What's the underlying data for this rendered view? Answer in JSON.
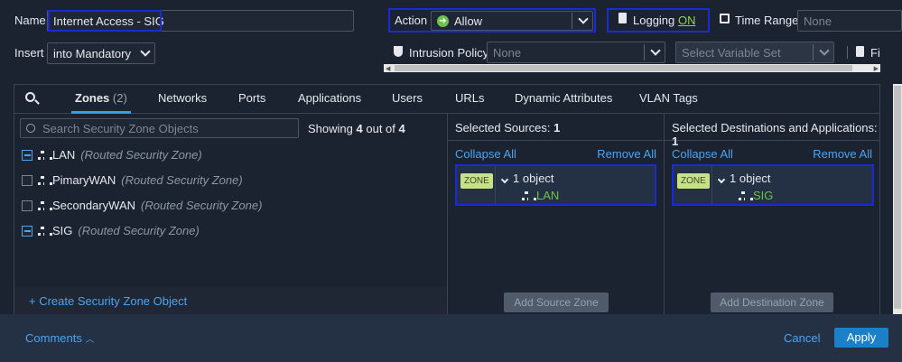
{
  "form": {
    "name_label": "Name",
    "name_value": "Internet Access - SIG",
    "action_label": "Action",
    "action_value": "Allow",
    "logging_label": "Logging",
    "logging_value": "ON",
    "time_range_label": "Time Range",
    "time_range_placeholder": "None",
    "insert_label": "Insert",
    "insert_value": "into Mandatory",
    "intrusion_label": "Intrusion Policy",
    "intrusion_value": "None",
    "variable_set_placeholder": "Select Variable Set",
    "file_label": "Fi"
  },
  "tabs": [
    {
      "label": "Zones",
      "count": "(2)"
    },
    {
      "label": "Networks"
    },
    {
      "label": "Ports"
    },
    {
      "label": "Applications"
    },
    {
      "label": "Users"
    },
    {
      "label": "URLs"
    },
    {
      "label": "Dynamic Attributes"
    },
    {
      "label": "VLAN Tags"
    }
  ],
  "zones_panel": {
    "search_placeholder": "Search Security Zone Objects",
    "showing_prefix": "Showing",
    "showing_count": "4",
    "showing_mid": "out of",
    "showing_total": "4",
    "items": [
      {
        "name": "LAN",
        "type": "(Routed Security Zone)",
        "checked": true
      },
      {
        "name": "PimaryWAN",
        "type": "(Routed Security Zone)",
        "checked": false
      },
      {
        "name": "SecondaryWAN",
        "type": "(Routed Security Zone)",
        "checked": false
      },
      {
        "name": "SIG",
        "type": "(Routed Security Zone)",
        "checked": true
      }
    ],
    "create_link": "+ Create Security Zone Object"
  },
  "sources": {
    "header_label": "Selected Sources:",
    "header_count": "1",
    "collapse_all": "Collapse All",
    "remove_all": "Remove All",
    "badge": "ZONE",
    "object_count": "1 object",
    "object_name": "LAN",
    "add_button": "Add Source Zone"
  },
  "destinations": {
    "header_label": "Selected Destinations and Applications:",
    "header_count": "1",
    "collapse_all": "Collapse All",
    "remove_all": "Remove All",
    "badge": "ZONE",
    "object_count": "1 object",
    "object_name": "SIG",
    "add_button": "Add Destination Zone"
  },
  "footer": {
    "comments": "Comments",
    "cancel": "Cancel",
    "apply": "Apply"
  },
  "colors": {
    "background": "#1b2330",
    "accent": "#33a0ee",
    "allow_green": "#6dc24b",
    "logging_on": "#8fd14f",
    "highlight_border": "#1a2bd6"
  }
}
